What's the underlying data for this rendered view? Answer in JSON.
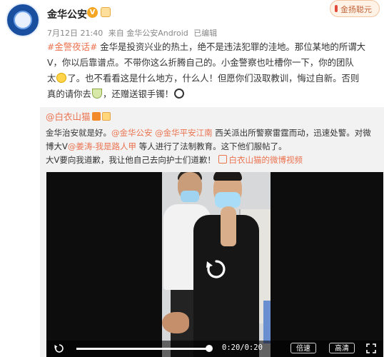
{
  "post": {
    "author": "金华公安",
    "verified_badge": "V",
    "meta": {
      "date": "7月12日 21:40",
      "source": "来自 金华公安Android",
      "edited": "已编辑"
    },
    "corner_label": "金扬聪元",
    "text": {
      "tag": "#金警夜话#",
      "line1_rest": " 金华是投资兴业的热土，绝不是违法犯罪的洼地。那位某地的所谓大",
      "line2": "V，你以后靠谱点。不带你这么折腾自己的。小金警察也吐槽你一下，你的团队",
      "line3": "太",
      "line3_rest": "了。也不看看这是什么地方，什么人！但愿你们汲取教训，悔过自新。否则",
      "line4": "真的请你去",
      "line4_rest": "，还赠送银手镯！"
    }
  },
  "repost": {
    "user": "@白衣山猫",
    "text": {
      "part1": "金华治安就是好。",
      "mention1": "@金华公安",
      "mention2": "@金华平安江南",
      "part2": " 西关派出所警察雷霆而动，迅速处警。对微",
      "part3": "博大V",
      "mention3": "@姜涛-我是路人甲",
      "part4": " 等人进行了法制教育。这下他们服帖了。",
      "part5": "大V要向我道歉，我让他自己去向护士们道歉！",
      "video_link": "白衣山猫的微博视频"
    },
    "video": {
      "time": "0:20/0:20",
      "progress": 1.0,
      "speed_label": "倍速",
      "quality_label": "高清"
    }
  },
  "icons": {
    "replay": "replay-icon",
    "fullscreen": "fullscreen-icon"
  },
  "colors": {
    "accent": "#eb7350",
    "verified": "#f5a623",
    "repost_bg": "#f2f2f2"
  }
}
